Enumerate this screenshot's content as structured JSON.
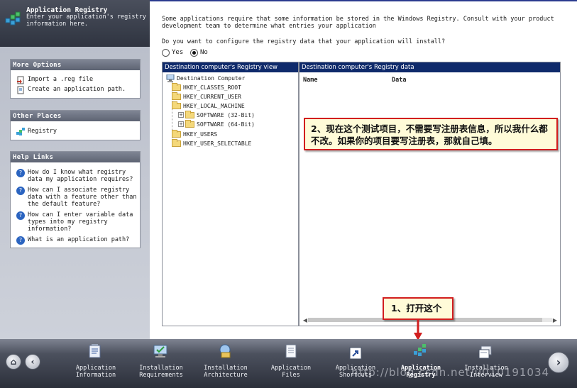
{
  "header": {
    "title": "Application Registry",
    "description": "Enter your application's registry information here."
  },
  "more_options": {
    "title": "More Options",
    "items": [
      {
        "label": "Import a .reg file"
      },
      {
        "label": "Create an application path."
      }
    ]
  },
  "other_places": {
    "title": "Other Places",
    "items": [
      {
        "label": "Registry"
      }
    ]
  },
  "help_links": {
    "title": "Help Links",
    "items": [
      {
        "label": "How do I know what registry data my application requires?"
      },
      {
        "label": "How can I associate registry data with a feature other than the default feature?"
      },
      {
        "label": "How can I enter variable data types into my registry information?"
      },
      {
        "label": "What is an application path?"
      }
    ]
  },
  "main": {
    "intro": "Some applications require that some information be stored in the Windows Registry. Consult with your product development team to determine what entries your application",
    "question": "Do you want to configure the registry data that your application will install?",
    "yes_label": "Yes",
    "no_label": "No",
    "selected": "No"
  },
  "tree_pane": {
    "title": "Destination computer's Registry view",
    "root": "Destination Computer",
    "nodes": [
      {
        "label": "HKEY_CLASSES_ROOT"
      },
      {
        "label": "HKEY_CURRENT_USER"
      },
      {
        "label": "HKEY_LOCAL_MACHINE"
      },
      {
        "label": "SOFTWARE (32-Bit)"
      },
      {
        "label": "SOFTWARE (64-Bit)"
      },
      {
        "label": "HKEY_USERS"
      },
      {
        "label": "HKEY_USER_SELECTABLE"
      }
    ]
  },
  "data_pane": {
    "title": "Destination computer's Registry data",
    "col_name": "Name",
    "col_data": "Data"
  },
  "annotations": {
    "note1": "2、现在这个测试项目，不需要写注册表信息，所以我什么都不改。如果你的项目要写注册表，那就自己填。",
    "note2": "1、打开这个",
    "border_color": "#d21e1e"
  },
  "steps": [
    {
      "label": "Application Information"
    },
    {
      "label": "Installation Requirements"
    },
    {
      "label": "Installation Architecture"
    },
    {
      "label": "Application Files"
    },
    {
      "label": "Application Shortcuts"
    },
    {
      "label": "Application Registry",
      "active": true
    },
    {
      "label": "Installation Interview"
    }
  ],
  "watermark": "http://blog.csdn.net/u010191034"
}
